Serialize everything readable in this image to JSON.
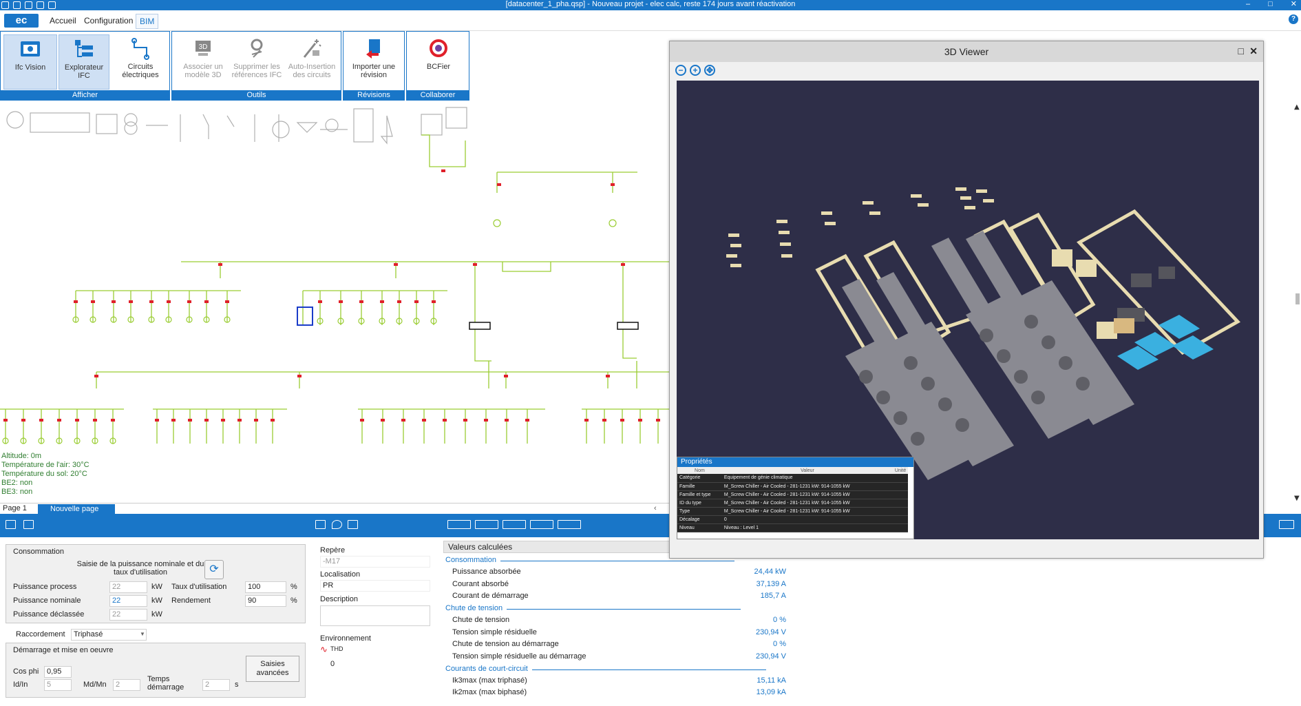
{
  "window": {
    "title": "[datacenter_1_pha.qsp] - Nouveau projet - elec calc, reste 174 jours avant réactivation",
    "controls": [
      "–",
      "□",
      "✕"
    ]
  },
  "menu": {
    "logo": "ec",
    "items": [
      "Accueil",
      "Configuration",
      "BIM"
    ],
    "help": "?"
  },
  "ribbon": {
    "groups": [
      {
        "label": "Afficher",
        "buttons": [
          "Ifc Vision",
          "Explorateur IFC",
          "Circuits électriques"
        ]
      },
      {
        "label": "Outils",
        "buttons": [
          "Associer un modèle 3D",
          "Supprimer les références IFC",
          "Auto-Insertion des circuits"
        ]
      },
      {
        "label": "Révisions",
        "buttons": [
          "Importer une révision"
        ]
      },
      {
        "label": "Collaborer",
        "buttons": [
          "BCFier"
        ]
      }
    ]
  },
  "diagram": {
    "environment": [
      "Altitude: 0m",
      "Température de l'air: 30°C",
      "Température du sol: 20°C",
      "BE2: non",
      "BE3: non"
    ]
  },
  "pages": {
    "current": "Page 1",
    "new": "Nouvelle page"
  },
  "consumption": {
    "title": "Consommation",
    "hint": "Saisie de la puissance nominale et du taux d'utilisation",
    "process_label": "Puissance process",
    "process_value": "22",
    "process_unit": "kW",
    "nominal_label": "Puissance nominale",
    "nominal_value": "22",
    "nominal_unit": "kW",
    "declassed_label": "Puissance déclassée",
    "declassed_value": "22",
    "declassed_unit": "kW",
    "usage_label": "Taux d'utilisation",
    "usage_value": "100",
    "usage_unit": "%",
    "efficiency_label": "Rendement",
    "efficiency_value": "90",
    "efficiency_unit": "%"
  },
  "connection": {
    "label": "Raccordement",
    "value": "Triphasé"
  },
  "startup": {
    "title": "Démarrage et mise en oeuvre",
    "cosphi_label": "Cos phi",
    "cosphi_value": "0,95",
    "idin_label": "Id/In",
    "idin_value": "5",
    "mdmn_label": "Md/Mn",
    "mdmn_value": "2",
    "time_label": "Temps démarrage",
    "time_value": "2",
    "time_unit": "s",
    "advanced_button": "Saisies avancées"
  },
  "info": {
    "repere_label": "Repère",
    "repere_value": "-M17",
    "localisation_label": "Localisation",
    "localisation_value": "PR",
    "description_label": "Description",
    "environment_label": "Environnement",
    "thd_label": "THD",
    "thd_value": "0"
  },
  "calc": {
    "title": "Valeurs calculées",
    "sections": [
      {
        "title": "Consommation",
        "rows": [
          {
            "label": "Puissance absorbée",
            "value": "24,44 kW"
          },
          {
            "label": "Courant absorbé",
            "value": "37,139 A"
          },
          {
            "label": "Courant de démarrage",
            "value": "185,7 A"
          }
        ]
      },
      {
        "title": "Chute de tension",
        "rows": [
          {
            "label": "Chute de tension",
            "value": "0 %"
          },
          {
            "label": "Tension simple résiduelle",
            "value": "230,94 V"
          },
          {
            "label": "Chute de tension au démarrage",
            "value": "0 %"
          },
          {
            "label": "Tension simple résiduelle au démarrage",
            "value": "230,94 V"
          }
        ]
      },
      {
        "title": "Courants de court-circuit",
        "rows": [
          {
            "label": "Ik3max (max triphasé)",
            "value": "15,11 kA"
          },
          {
            "label": "Ik2max (max biphasé)",
            "value": "13,09 kA"
          }
        ]
      }
    ]
  },
  "viewer": {
    "title": "3D Viewer",
    "tools": [
      "−",
      "+",
      "✥"
    ],
    "properties": {
      "title": "Propriétés",
      "columns": [
        "Nom",
        "Valeur",
        "Unité"
      ],
      "rows": [
        {
          "name": "Catégorie",
          "value": "Equipement de génie climatique"
        },
        {
          "name": "Famille",
          "value": "M_Screw Chiller - Air Cooled - 281-1231 kW: 914-1055 kW"
        },
        {
          "name": "Famille et type",
          "value": "M_Screw Chiller - Air Cooled - 281-1231 kW: 914-1055 kW"
        },
        {
          "name": "ID du type",
          "value": "M_Screw Chiller - Air Cooled - 281-1231 kW: 914-1055 kW"
        },
        {
          "name": "Type",
          "value": "M_Screw Chiller - Air Cooled - 281-1231 kW: 914-1055 kW"
        },
        {
          "name": "Décalage",
          "value": "0"
        },
        {
          "name": "Niveau",
          "value": "Niveau : Level 1"
        }
      ]
    }
  },
  "colors": {
    "accent": "#1976c8",
    "scene_bg": "#2e2e48",
    "wire": "#9acd32",
    "breaker": "#e0202a"
  }
}
